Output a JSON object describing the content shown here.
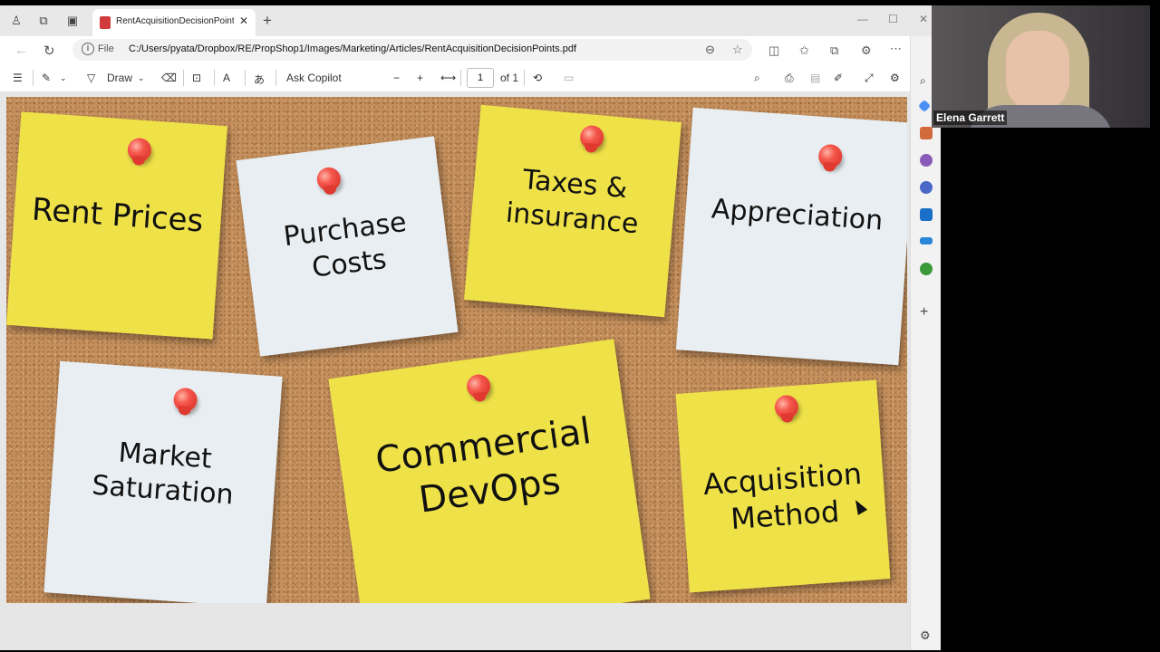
{
  "browser": {
    "tab_title": "RentAcquisitionDecisionPoints.pdf",
    "tab_close": "✕",
    "new_tab": "+",
    "file_label": "File",
    "url": "C:/Users/pyata/Dropbox/RE/PropShop1/Images/Marketing/Articles/RentAcquisitionDecisionPoints.pdf"
  },
  "pdf_toolbar": {
    "draw_label": "Draw",
    "copilot_label": "Ask Copilot",
    "page_current": "1",
    "page_total": "of 1"
  },
  "notes": [
    {
      "text": "Rent Prices",
      "color": "yellow"
    },
    {
      "text": "Purchase Costs",
      "color": "white"
    },
    {
      "text": "Taxes & insurance",
      "color": "yellow"
    },
    {
      "text": "Appreciation",
      "color": "white"
    },
    {
      "text": "Market Saturation",
      "color": "white"
    },
    {
      "text": "Commercial DevOps",
      "color": "yellow"
    },
    {
      "text": "Acquisition Method",
      "color": "yellow"
    }
  ],
  "video": {
    "participant_name": "Elena Garrett"
  },
  "colors": {
    "note_yellow": "#efe249",
    "note_white": "#e9eef2",
    "pin_red": "#e0392f",
    "cork": "#c48f5c"
  }
}
